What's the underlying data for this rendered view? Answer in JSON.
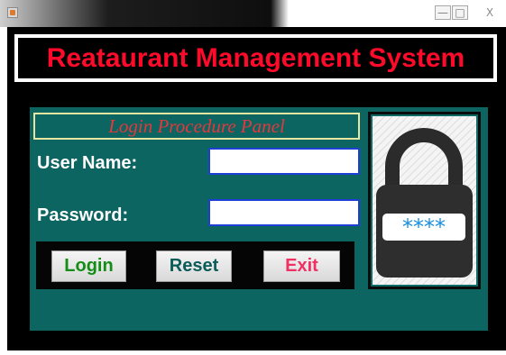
{
  "window": {
    "minimize_glyph": "—",
    "maximize_glyph": "□",
    "close_glyph": "X"
  },
  "header": {
    "title": "Reataurant Management System",
    "title_color": "#ff0a2a"
  },
  "login_panel": {
    "title": "Login Procedure Panel",
    "username_label": "User Name:",
    "username_value": "",
    "password_label": "Password:",
    "password_value": "",
    "panel_color": "#0d6562"
  },
  "buttons": {
    "login_label": "Login",
    "reset_label": "Reset",
    "exit_label": "Exit"
  },
  "lock_image": {
    "icon": "padlock-icon",
    "masked_text": "****"
  }
}
